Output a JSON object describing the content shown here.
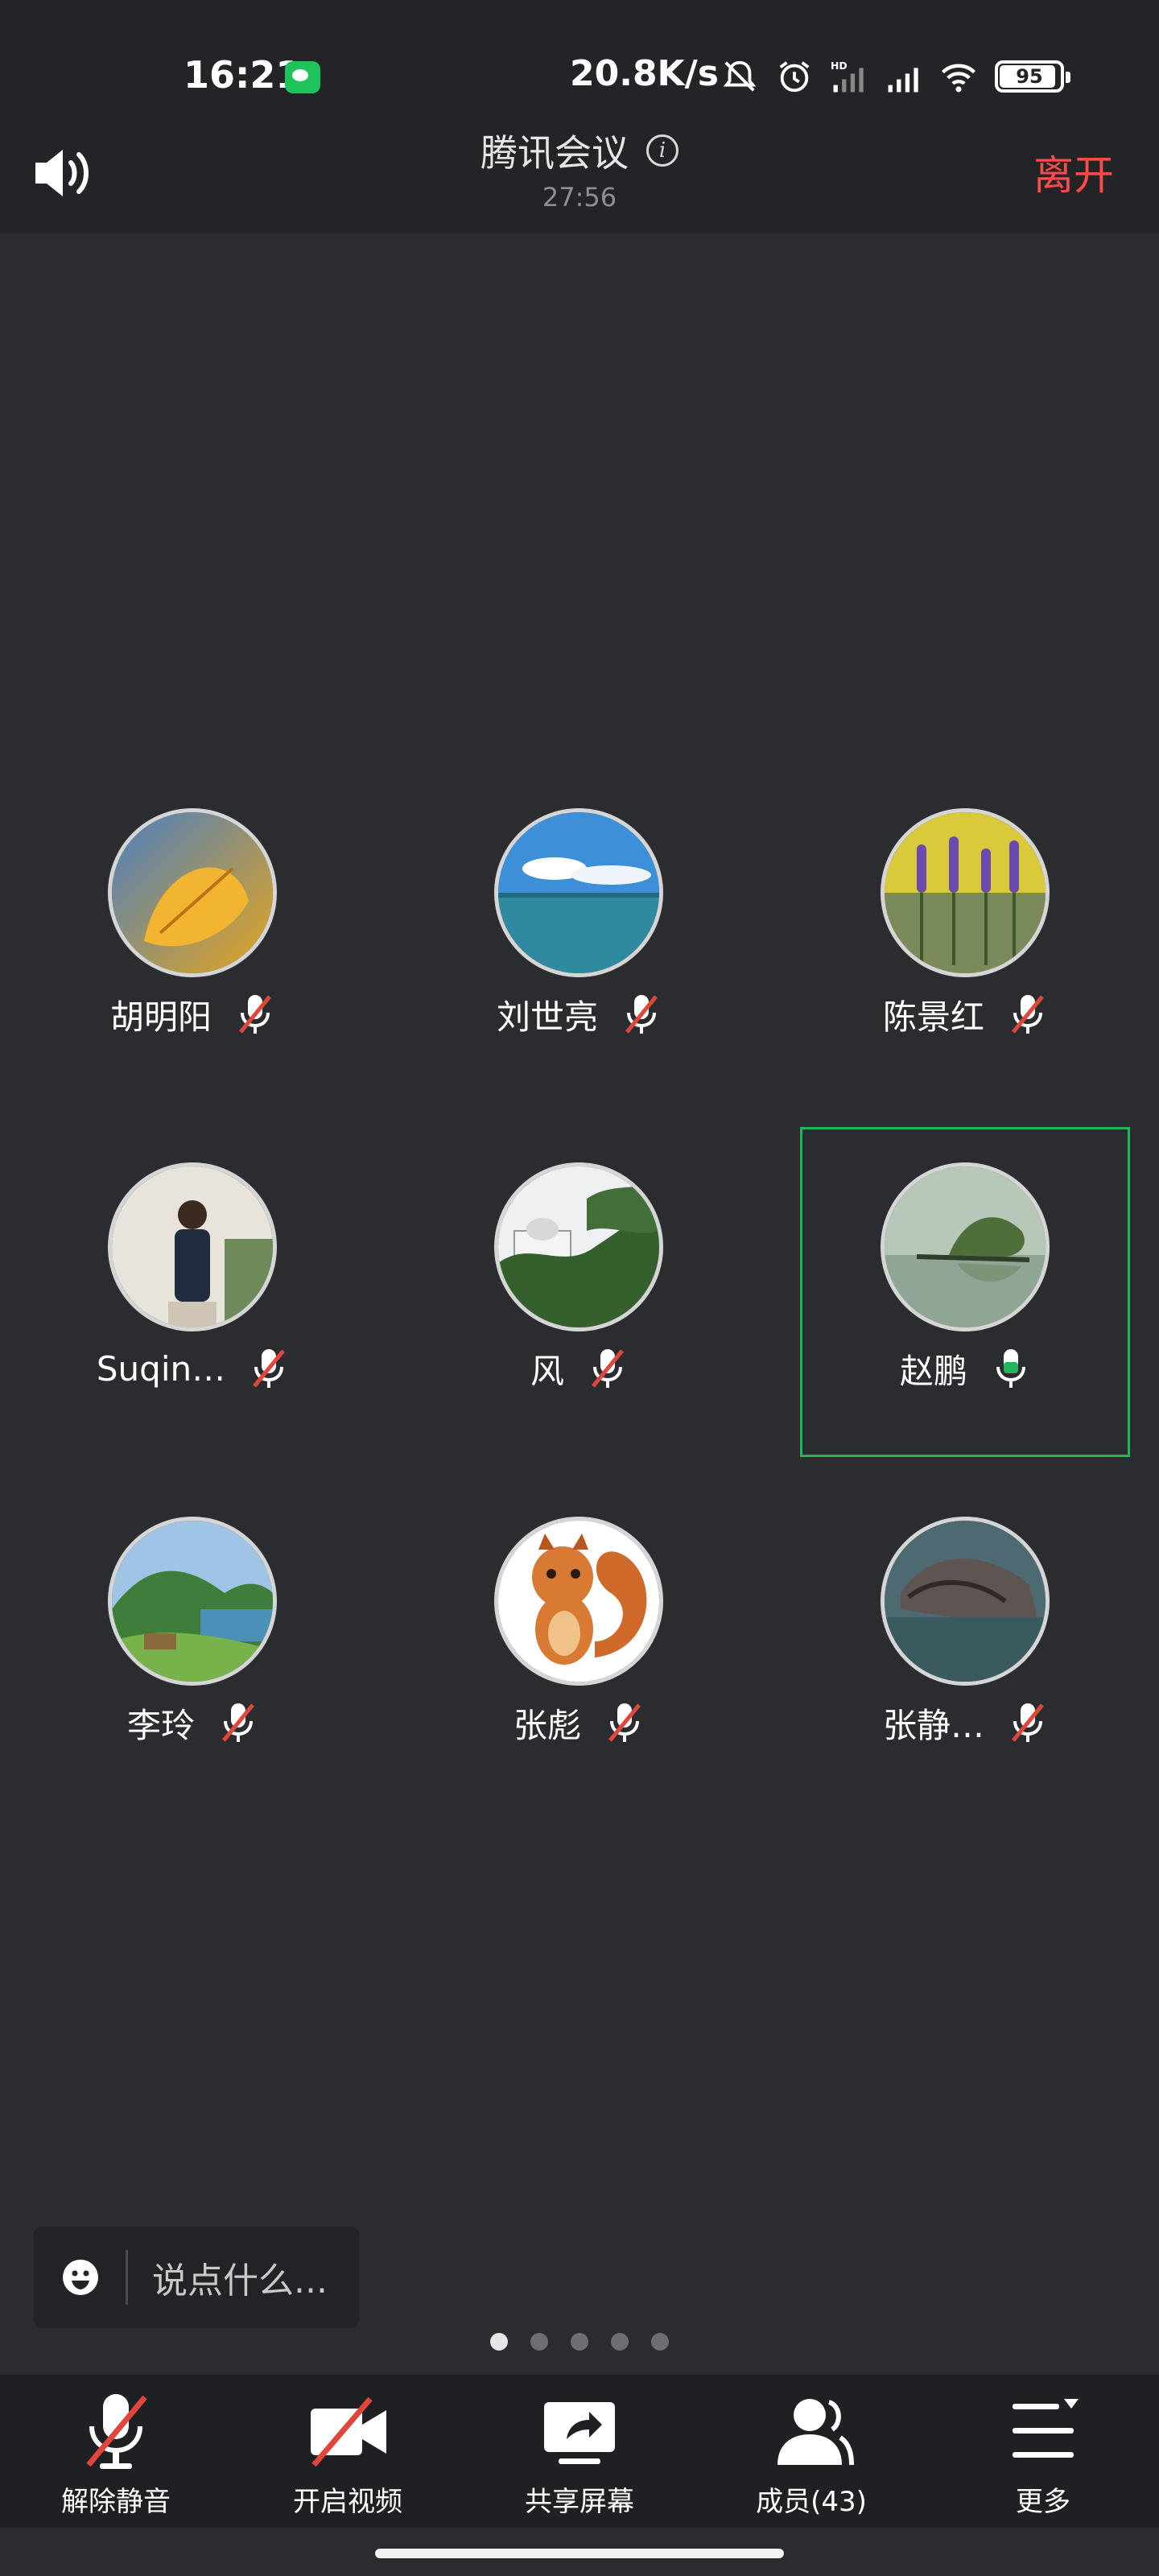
{
  "status_bar": {
    "time": "16:21",
    "net_speed": "20.8K/s",
    "battery": "95"
  },
  "header": {
    "title": "腾讯会议",
    "duration": "27:56",
    "leave_label": "离开"
  },
  "participants": [
    {
      "name": "胡明阳",
      "muted": true
    },
    {
      "name": "刘世亮",
      "muted": true
    },
    {
      "name": "陈景红",
      "muted": true
    },
    {
      "name": "Suqin…",
      "muted": true
    },
    {
      "name": "风",
      "muted": true
    },
    {
      "name": "赵鹏",
      "muted": false,
      "active": true
    },
    {
      "name": "李玲",
      "muted": true
    },
    {
      "name": "张彪",
      "muted": true
    },
    {
      "name": "张静…",
      "muted": true
    }
  ],
  "chat": {
    "placeholder": "说点什么..."
  },
  "page_dots": {
    "count": 5,
    "current": 1
  },
  "toolbar": {
    "unmute_label": "解除静音",
    "video_label": "开启视频",
    "share_label": "共享屏幕",
    "members_label": "成员(43)",
    "more_label": "更多"
  },
  "colors": {
    "background": "#2b2c30",
    "bar": "#232427",
    "leave": "#ff4a4a",
    "active_border": "#23b55a",
    "mute_red": "#e2453b"
  }
}
